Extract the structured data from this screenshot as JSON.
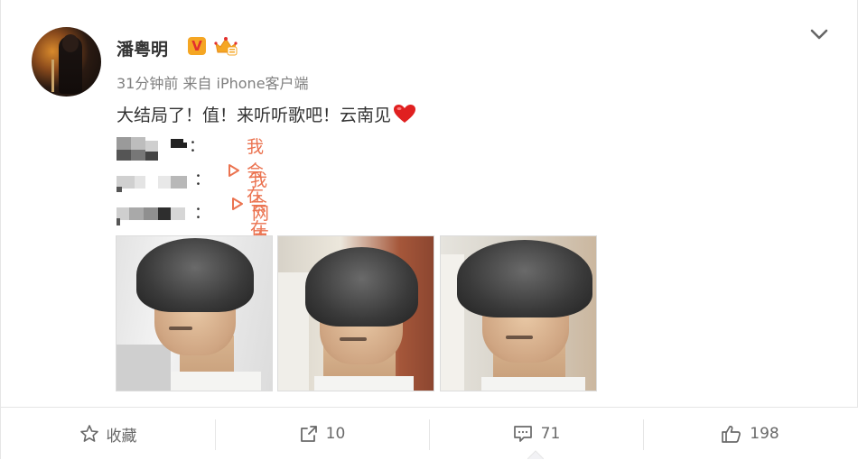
{
  "post": {
    "author": "潘粤明",
    "verified_badge": "V",
    "meta": "31分钟前 来自 iPhone客户端",
    "text": "大结局了！值！来听听歌吧！云南见",
    "emoji": "heart-emoji",
    "links": [
      {
        "label": "我会在",
        "icon": "play-triangle-icon"
      },
      {
        "label": "我会在",
        "icon": "play-triangle-icon"
      },
      {
        "label": "网页链接",
        "icon": "chain-link-icon"
      }
    ],
    "colon": "：",
    "accent_color": "#eb7350"
  },
  "actions": {
    "favorite": "收藏",
    "repost": "10",
    "comment": "71",
    "like": "198"
  }
}
